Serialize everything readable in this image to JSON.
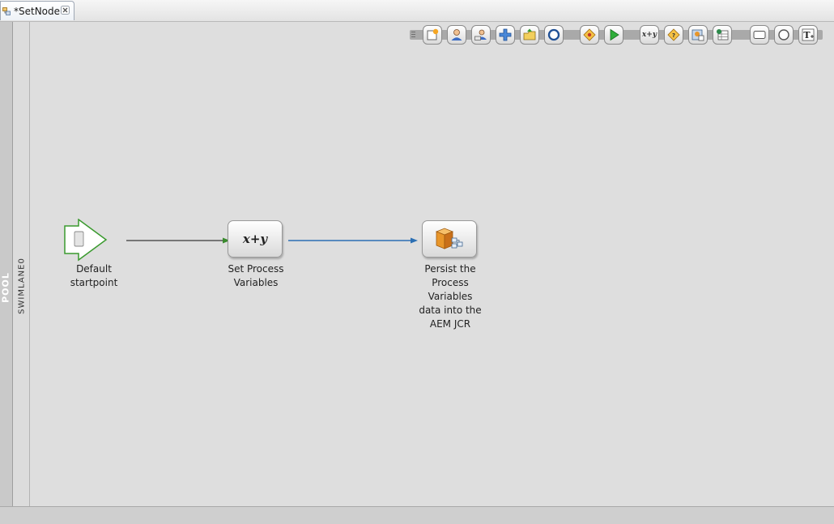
{
  "tab": {
    "title": "*SetNode",
    "icon": "process-icon"
  },
  "pool": {
    "label": "POOL"
  },
  "lane": {
    "label": "SWIMLANE0"
  },
  "palette": {
    "buttons": [
      {
        "name": "palette-new-task-icon"
      },
      {
        "name": "palette-user-icon"
      },
      {
        "name": "palette-assign-user-icon"
      },
      {
        "name": "palette-add-icon"
      },
      {
        "name": "palette-open-folder-icon"
      },
      {
        "name": "palette-end-event-icon"
      },
      {
        "name": "palette-gateway-icon"
      },
      {
        "name": "palette-start-icon"
      },
      {
        "name": "palette-set-value-icon",
        "text": "x+y"
      },
      {
        "name": "palette-decision-icon"
      },
      {
        "name": "palette-invoke-service-icon"
      },
      {
        "name": "palette-database-icon"
      },
      {
        "name": "palette-rectangle-icon"
      },
      {
        "name": "palette-circle-icon"
      },
      {
        "name": "palette-text-icon"
      }
    ]
  },
  "nodes": {
    "start": {
      "label_line1": "Default",
      "label_line2": "startpoint"
    },
    "set_variables": {
      "formula": "x+y",
      "label_line1": "Set Process",
      "label_line2": "Variables"
    },
    "persist": {
      "label_lines": [
        "Persist the",
        "Process",
        "Variables",
        "data into the",
        "AEM JCR"
      ]
    }
  },
  "colors": {
    "start_green": "#3a9a2e",
    "arrow_gray": "#555555",
    "arrow_blue": "#2c6fb3",
    "box_orange": "#e8962a"
  }
}
